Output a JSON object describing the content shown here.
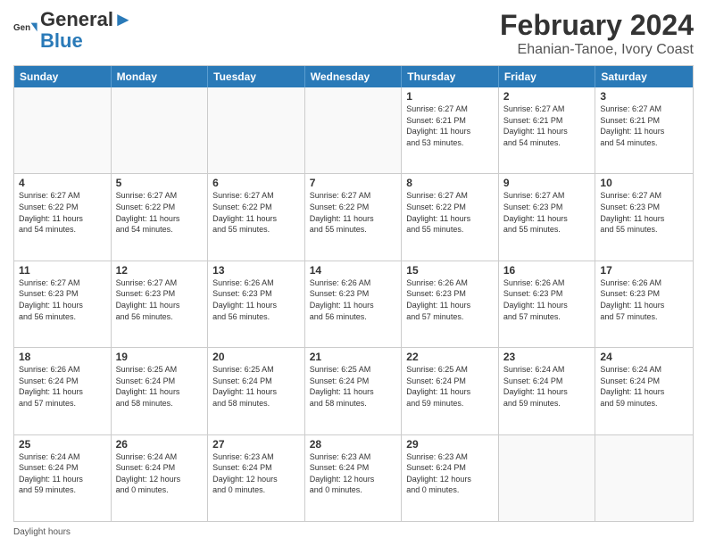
{
  "header": {
    "logo_line1": "General",
    "logo_line2": "Blue",
    "month_title": "February 2024",
    "subtitle": "Ehanian-Tanoe, Ivory Coast"
  },
  "calendar": {
    "days_of_week": [
      "Sunday",
      "Monday",
      "Tuesday",
      "Wednesday",
      "Thursday",
      "Friday",
      "Saturday"
    ],
    "rows": [
      [
        {
          "day": "",
          "info": ""
        },
        {
          "day": "",
          "info": ""
        },
        {
          "day": "",
          "info": ""
        },
        {
          "day": "",
          "info": ""
        },
        {
          "day": "1",
          "info": "Sunrise: 6:27 AM\nSunset: 6:21 PM\nDaylight: 11 hours\nand 53 minutes."
        },
        {
          "day": "2",
          "info": "Sunrise: 6:27 AM\nSunset: 6:21 PM\nDaylight: 11 hours\nand 54 minutes."
        },
        {
          "day": "3",
          "info": "Sunrise: 6:27 AM\nSunset: 6:21 PM\nDaylight: 11 hours\nand 54 minutes."
        }
      ],
      [
        {
          "day": "4",
          "info": "Sunrise: 6:27 AM\nSunset: 6:22 PM\nDaylight: 11 hours\nand 54 minutes."
        },
        {
          "day": "5",
          "info": "Sunrise: 6:27 AM\nSunset: 6:22 PM\nDaylight: 11 hours\nand 54 minutes."
        },
        {
          "day": "6",
          "info": "Sunrise: 6:27 AM\nSunset: 6:22 PM\nDaylight: 11 hours\nand 55 minutes."
        },
        {
          "day": "7",
          "info": "Sunrise: 6:27 AM\nSunset: 6:22 PM\nDaylight: 11 hours\nand 55 minutes."
        },
        {
          "day": "8",
          "info": "Sunrise: 6:27 AM\nSunset: 6:22 PM\nDaylight: 11 hours\nand 55 minutes."
        },
        {
          "day": "9",
          "info": "Sunrise: 6:27 AM\nSunset: 6:23 PM\nDaylight: 11 hours\nand 55 minutes."
        },
        {
          "day": "10",
          "info": "Sunrise: 6:27 AM\nSunset: 6:23 PM\nDaylight: 11 hours\nand 55 minutes."
        }
      ],
      [
        {
          "day": "11",
          "info": "Sunrise: 6:27 AM\nSunset: 6:23 PM\nDaylight: 11 hours\nand 56 minutes."
        },
        {
          "day": "12",
          "info": "Sunrise: 6:27 AM\nSunset: 6:23 PM\nDaylight: 11 hours\nand 56 minutes."
        },
        {
          "day": "13",
          "info": "Sunrise: 6:26 AM\nSunset: 6:23 PM\nDaylight: 11 hours\nand 56 minutes."
        },
        {
          "day": "14",
          "info": "Sunrise: 6:26 AM\nSunset: 6:23 PM\nDaylight: 11 hours\nand 56 minutes."
        },
        {
          "day": "15",
          "info": "Sunrise: 6:26 AM\nSunset: 6:23 PM\nDaylight: 11 hours\nand 57 minutes."
        },
        {
          "day": "16",
          "info": "Sunrise: 6:26 AM\nSunset: 6:23 PM\nDaylight: 11 hours\nand 57 minutes."
        },
        {
          "day": "17",
          "info": "Sunrise: 6:26 AM\nSunset: 6:23 PM\nDaylight: 11 hours\nand 57 minutes."
        }
      ],
      [
        {
          "day": "18",
          "info": "Sunrise: 6:26 AM\nSunset: 6:24 PM\nDaylight: 11 hours\nand 57 minutes."
        },
        {
          "day": "19",
          "info": "Sunrise: 6:25 AM\nSunset: 6:24 PM\nDaylight: 11 hours\nand 58 minutes."
        },
        {
          "day": "20",
          "info": "Sunrise: 6:25 AM\nSunset: 6:24 PM\nDaylight: 11 hours\nand 58 minutes."
        },
        {
          "day": "21",
          "info": "Sunrise: 6:25 AM\nSunset: 6:24 PM\nDaylight: 11 hours\nand 58 minutes."
        },
        {
          "day": "22",
          "info": "Sunrise: 6:25 AM\nSunset: 6:24 PM\nDaylight: 11 hours\nand 59 minutes."
        },
        {
          "day": "23",
          "info": "Sunrise: 6:24 AM\nSunset: 6:24 PM\nDaylight: 11 hours\nand 59 minutes."
        },
        {
          "day": "24",
          "info": "Sunrise: 6:24 AM\nSunset: 6:24 PM\nDaylight: 11 hours\nand 59 minutes."
        }
      ],
      [
        {
          "day": "25",
          "info": "Sunrise: 6:24 AM\nSunset: 6:24 PM\nDaylight: 11 hours\nand 59 minutes."
        },
        {
          "day": "26",
          "info": "Sunrise: 6:24 AM\nSunset: 6:24 PM\nDaylight: 12 hours\nand 0 minutes."
        },
        {
          "day": "27",
          "info": "Sunrise: 6:23 AM\nSunset: 6:24 PM\nDaylight: 12 hours\nand 0 minutes."
        },
        {
          "day": "28",
          "info": "Sunrise: 6:23 AM\nSunset: 6:24 PM\nDaylight: 12 hours\nand 0 minutes."
        },
        {
          "day": "29",
          "info": "Sunrise: 6:23 AM\nSunset: 6:24 PM\nDaylight: 12 hours\nand 0 minutes."
        },
        {
          "day": "",
          "info": ""
        },
        {
          "day": "",
          "info": ""
        }
      ]
    ]
  },
  "footer": {
    "text": "Daylight hours"
  },
  "colors": {
    "header_bg": "#2a7ab8",
    "header_text": "#ffffff",
    "accent": "#2a7ab8"
  }
}
